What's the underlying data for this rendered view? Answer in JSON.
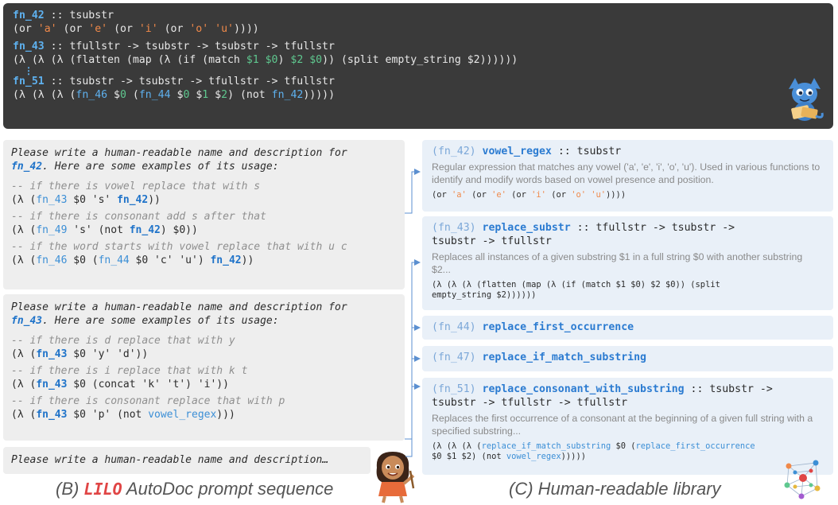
{
  "top_code": {
    "fn42_sig": {
      "name": "fn_42",
      "sep": " :: ",
      "type": "tsubstr"
    },
    "fn42_body": {
      "p1": "(or ",
      "a": "'a'",
      "p2": " (or ",
      "e": "'e'",
      "p3": " (or ",
      "i": "'i'",
      "p4": " (or ",
      "o": "'o'",
      "p5": " ",
      "u": "'u'",
      "p6": "))))"
    },
    "fn43_sig": {
      "name": "fn_43",
      "sep": " :: ",
      "type": "tfullstr -> tsubstr -> tsubstr -> tfullstr"
    },
    "fn43_body": {
      "p1": "(λ (λ (λ (flatten (map (λ (if (match ",
      "v1": "$1",
      "s1": " ",
      "v0": "$0",
      "p2": ") ",
      "v2": "$2",
      "s2": " ",
      "v0b": "$0",
      "p3": ")) (split empty_string $2))))))"
    },
    "vdots": "⋮",
    "fn51_sig": {
      "name": "fn_51",
      "sep": " :: ",
      "type": "tsubstr -> tsubstr -> tfullstr -> tfullstr"
    },
    "fn51_body": {
      "p1": "(λ (λ (λ (",
      "f46": "fn_46",
      "p2": " $",
      "v0": "0",
      "p3": " (",
      "f44": "fn_44",
      "p4": " $",
      "v0b": "0",
      "p5": " $",
      "v1": "1",
      "p6": " $",
      "v2": "2",
      "p7": ") (not ",
      "f42": "fn_42",
      "p8": ")))))"
    }
  },
  "prompt_a": {
    "l1": "Please write a human-readable name and description for",
    "l2_ref": "fn_42",
    "l2_rest": ". Here are some examples of its usage:",
    "ex": [
      {
        "comment": "-- if there is vowel replace that with s",
        "c1": "(λ (",
        "f": "fn_43",
        "c2": " $0 's' ",
        "r": "fn_42",
        "c3": "))"
      },
      {
        "comment": "-- if there is consonant add s after that",
        "c1": "(λ (",
        "f": "fn_49",
        "c2": " 's' (not ",
        "r": "fn_42",
        "c3": ") $0))"
      },
      {
        "comment": "-- if the word starts with vowel replace that with u c",
        "c1": "(λ (",
        "f": "fn_46",
        "c2": " $0 (",
        "f2": "fn_44",
        "c3": " $0 'c' 'u') ",
        "r": "fn_42",
        "c4": "))"
      }
    ]
  },
  "prompt_b": {
    "l1": "Please write a human-readable name and description for",
    "l2_ref": "fn_43",
    "l2_rest": ". Here are some examples of its usage:",
    "ex": [
      {
        "comment": "-- if there is d replace that with y",
        "c1": "(λ (",
        "f": "fn_43",
        "c2": " $0 'y' 'd'))"
      },
      {
        "comment": "-- if there is i replace that with k t",
        "c1": "(λ (",
        "f": "fn_43",
        "c2": " $0 (concat 'k' 't') 'i'))"
      },
      {
        "comment": "-- if there is consonant replace that with p",
        "c1": "(λ (",
        "f": "fn_43",
        "c2": " $0 'p' (not ",
        "r": "vowel_regex",
        "c3": ")))"
      }
    ]
  },
  "prompt_c": {
    "text": "Please write a human-readable name and description…"
  },
  "library": {
    "fn42": {
      "id": "(fn_42)",
      "name": "vowel_regex",
      "type": " :: tsubstr",
      "desc": "Regular expression that matches any vowel ('a', 'e', 'i', 'o', 'u'). Used in various functions to identify and modify words based on vowel presence and position.",
      "c1": "(or ",
      "a": "'a'",
      "c2": " (or ",
      "e": "'e'",
      "c3": " (or ",
      "i": "'i'",
      "c4": " (or ",
      "o": "'o'",
      "c5": " ",
      "u": "'u'",
      "c6": "))))"
    },
    "fn43": {
      "id": "(fn_43)",
      "name": "replace_substr",
      "type": " :: tfullstr -> tsubstr ->",
      "type2": "tsubstr -> tfullstr",
      "desc": "Replaces all instances of a given substring $1 in a full string $0 with another substring $2...",
      "code1": "(λ (λ (λ (flatten (map (λ (if (match $1 $0) $2 $0)) (split",
      "code2": "empty_string $2))))))"
    },
    "fn44": {
      "id": "(fn_44)",
      "name": "replace_first_occurrence"
    },
    "fn47": {
      "id": "(fn_47)",
      "name": "replace_if_match_substring"
    },
    "fn51": {
      "id": "(fn_51)",
      "name": "replace_consonant_with_substring",
      "type": " :: tsubstr ->",
      "type2": "tsubstr -> tfullstr -> tfullstr",
      "desc": "Replaces the first occurrence of a consonant at the beginning of a given full string with a specified substring...",
      "c1": "(λ (λ (λ (",
      "r1": "replace_if_match_substring",
      "c2": " $0 (",
      "r2": "replace_first_occurrence",
      "c3": "$0 $1 $2) (not ",
      "r3": "vowel_regex",
      "c4": ")))))"
    }
  },
  "captions": {
    "left_pre": "(B) ",
    "left_brand": "LILO",
    "left_post": " AutoDoc prompt sequence",
    "right": "(C) Human-readable library"
  },
  "colors": {
    "panel_dark": "#3a3a3a",
    "fn_blue": "#5eb1ef",
    "string_orange": "#f0894a",
    "var_green": "#5fc88f",
    "prompt_bg": "#eeeeee",
    "card_bg": "#e9f0f8",
    "brand_red": "#e04545",
    "connector": "#5b8fd0"
  },
  "icons": [
    "dragon-mascot-icon",
    "girl-mascot-icon",
    "network-graph-icon"
  ]
}
